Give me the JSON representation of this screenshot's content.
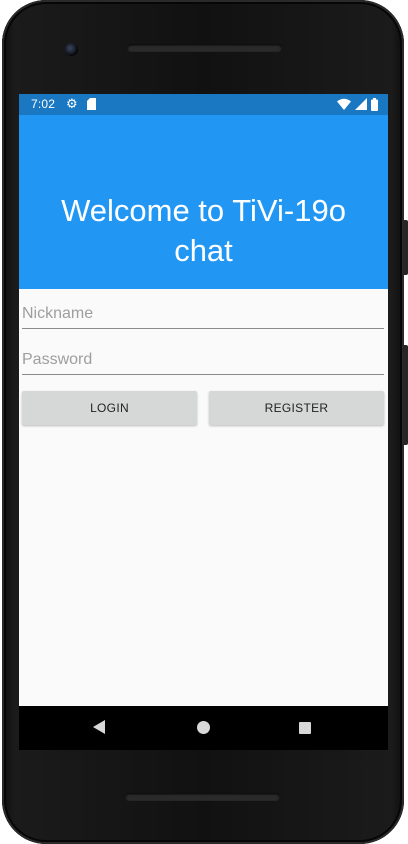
{
  "status_bar": {
    "time": "7:02",
    "icons": [
      "gear-icon",
      "sd-card-icon",
      "wifi-icon",
      "cell-signal-icon",
      "battery-icon"
    ]
  },
  "app_bar": {
    "title": "Welcome to TiVi-19o chat",
    "background": "#2196f3"
  },
  "form": {
    "nickname_placeholder": "Nickname",
    "nickname_value": "",
    "password_placeholder": "Password",
    "password_value": "",
    "login_label": "LOGIN",
    "register_label": "REGISTER"
  },
  "nav_bar": {
    "icons": [
      "back-icon",
      "home-icon",
      "recents-icon"
    ]
  },
  "colors": {
    "status_bar": "#1a78c2",
    "accent": "#2196f3",
    "button": "#d6d7d7"
  }
}
